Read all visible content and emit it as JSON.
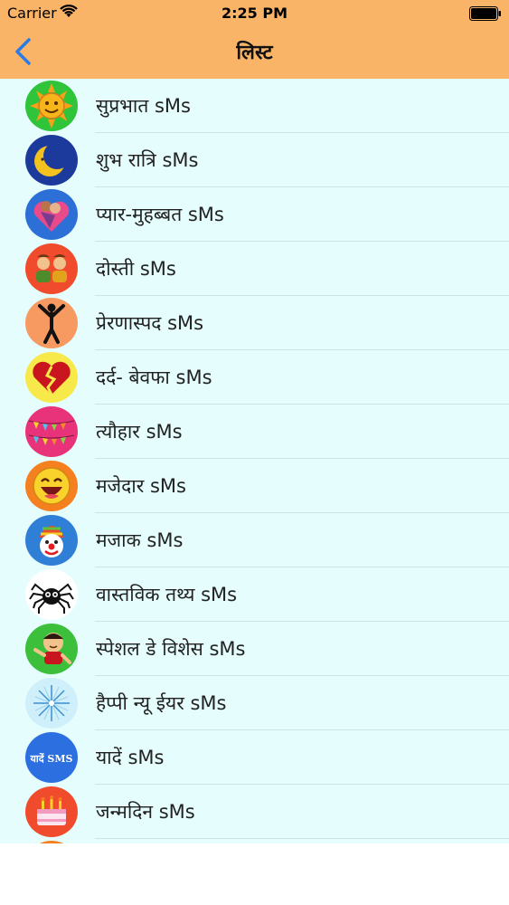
{
  "status_bar": {
    "carrier": "Carrier",
    "time": "2:25 PM"
  },
  "nav": {
    "title": "लिस्ट",
    "back_icon": "chevron-left-icon"
  },
  "colors": {
    "header": "#f9b468",
    "list_background": "#e5fdfd",
    "back_tint": "#2a7be4"
  },
  "items": [
    {
      "label": "सुप्रभात sMs",
      "icon": "sun-face-icon"
    },
    {
      "label": "शुभ रात्रि sMs",
      "icon": "crescent-moon-icon"
    },
    {
      "label": "प्यार-मुहब्बत sMs",
      "icon": "couple-heart-icon"
    },
    {
      "label": "दोस्ती sMs",
      "icon": "friends-icon"
    },
    {
      "label": "प्रेरणास्पद sMs",
      "icon": "person-arms-up-icon"
    },
    {
      "label": "दर्द- बेवफा sMs",
      "icon": "broken-heart-icon"
    },
    {
      "label": "त्यौहार sMs",
      "icon": "bunting-flags-icon"
    },
    {
      "label": "मजेदार sMs",
      "icon": "laughing-face-icon"
    },
    {
      "label": "मजाक sMs",
      "icon": "clown-icon"
    },
    {
      "label": "वास्तविक तथ्य sMs",
      "icon": "spider-icon"
    },
    {
      "label": "स्पेशल डे विशेस sMs",
      "icon": "cartoon-boy-icon"
    },
    {
      "label": "हैप्पी न्यू ईयर sMs",
      "icon": "fireworks-icon"
    },
    {
      "label": "यादें sMs",
      "icon": "yaaden-sms-badge-icon",
      "badge_text": "यादें SMS"
    },
    {
      "label": "जन्मदिन sMs",
      "icon": "birthday-cake-icon"
    }
  ]
}
